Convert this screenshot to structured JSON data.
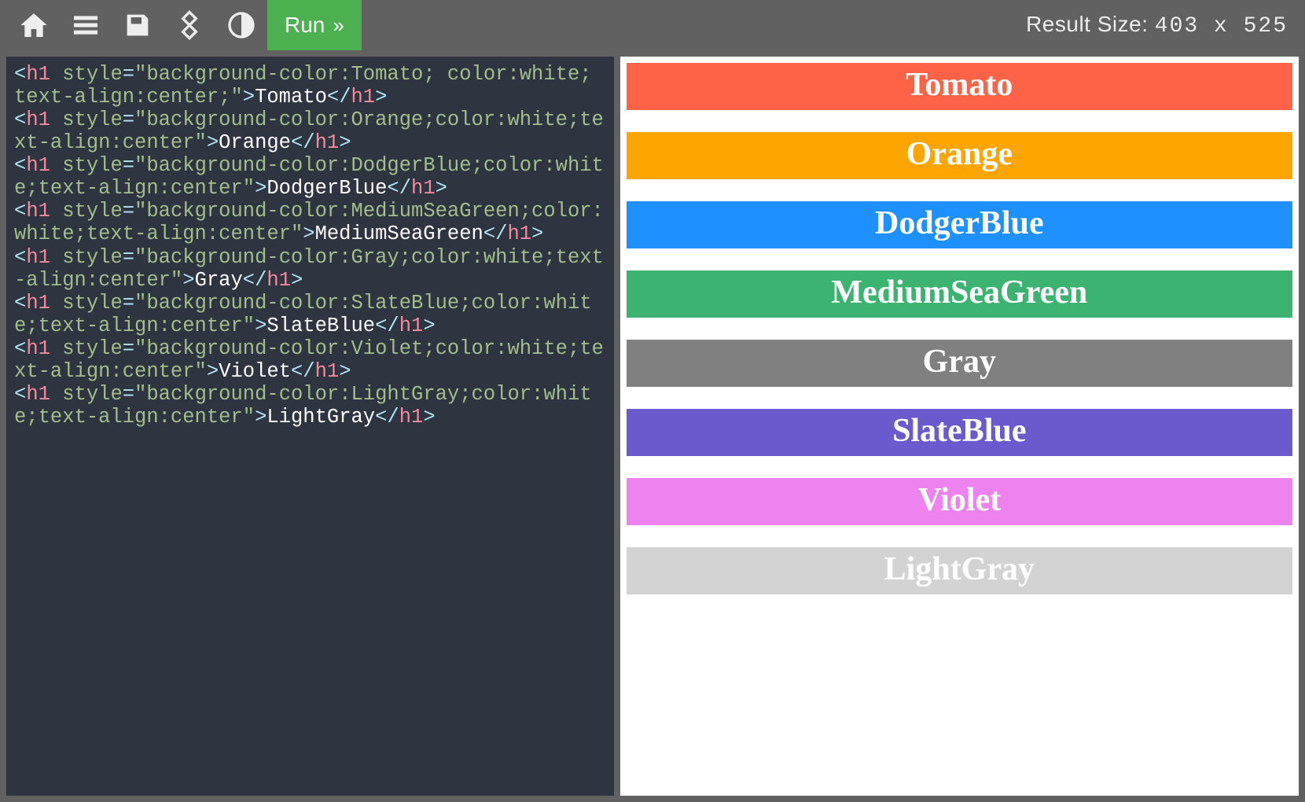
{
  "toolbar": {
    "run_label": "Run",
    "result_size_label": "Result Size:",
    "result_size_value": "403 x 525"
  },
  "code": {
    "lines": [
      {
        "tag": "h1",
        "style": "background-color:Tomato; color:white; text-align:center;",
        "text": "Tomato"
      },
      {
        "tag": "h1",
        "style": "background-color:Orange;color:white;text-align:center",
        "text": "Orange"
      },
      {
        "tag": "h1",
        "style": "background-color:DodgerBlue;color:white;text-align:center",
        "text": "DodgerBlue"
      },
      {
        "tag": "h1",
        "style": "background-color:MediumSeaGreen;color:white;text-align:center",
        "text": "MediumSeaGreen"
      },
      {
        "tag": "h1",
        "style": "background-color:Gray;color:white;text-align:center",
        "text": "Gray"
      },
      {
        "tag": "h1",
        "style": "background-color:SlateBlue;color:white;text-align:center",
        "text": "SlateBlue"
      },
      {
        "tag": "h1",
        "style": "background-color:Violet;color:white;text-align:center",
        "text": "Violet"
      },
      {
        "tag": "h1",
        "style": "background-color:LightGray;color:white;text-align:center",
        "text": "LightGray"
      }
    ]
  },
  "preview": {
    "blocks": [
      {
        "label": "Tomato",
        "bg": "Tomato"
      },
      {
        "label": "Orange",
        "bg": "Orange"
      },
      {
        "label": "DodgerBlue",
        "bg": "DodgerBlue"
      },
      {
        "label": "MediumSeaGreen",
        "bg": "MediumSeaGreen"
      },
      {
        "label": "Gray",
        "bg": "Gray"
      },
      {
        "label": "SlateBlue",
        "bg": "SlateBlue"
      },
      {
        "label": "Violet",
        "bg": "Violet"
      },
      {
        "label": "LightGray",
        "bg": "LightGray"
      }
    ]
  }
}
